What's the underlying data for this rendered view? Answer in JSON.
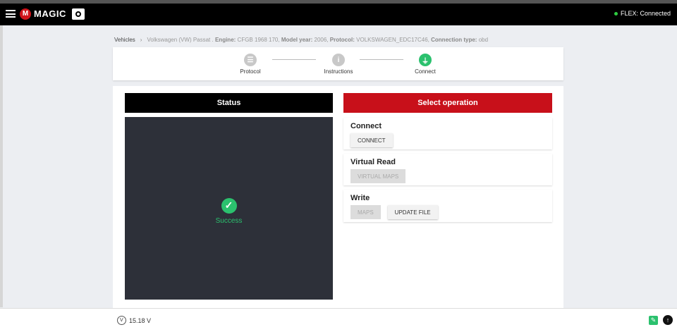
{
  "app": {
    "logo_letter": "M",
    "logo_text": "MAGIC",
    "connection_status": "FLEX: Connected"
  },
  "breadcrumb": {
    "root": "Vehicles",
    "vehicle": "Volkswagen (VW) Passat .",
    "engine_label": "Engine:",
    "engine_value": "CFGB 1968 170,",
    "year_label": "Model year:",
    "year_value": "2006,",
    "protocol_label": "Protocol:",
    "protocol_value": "VOLKSWAGEN_EDC17C46,",
    "conn_type_label": "Connection type:",
    "conn_type_value": "obd"
  },
  "stepper": {
    "steps": [
      {
        "label": "Protocol",
        "icon": "list-icon",
        "state": "inactive"
      },
      {
        "label": "Instructions",
        "icon": "info-icon",
        "state": "inactive"
      },
      {
        "label": "Connect",
        "icon": "plug-icon",
        "state": "done"
      }
    ]
  },
  "status": {
    "header": "Status",
    "result": "Success",
    "result_icon": "check-circle-icon"
  },
  "operations": {
    "header": "Select operation",
    "connect": {
      "title": "Connect",
      "button": "CONNECT"
    },
    "virtual_read": {
      "title": "Virtual Read",
      "button": "VIRTUAL MAPS"
    },
    "write": {
      "title": "Write",
      "maps_button": "MAPS",
      "update_button": "UPDATE FILE"
    }
  },
  "footer": {
    "voltage": "15.18 V",
    "voltage_icon_letter": "V"
  },
  "colors": {
    "topbar": "#000000",
    "brand_red": "#c8101a",
    "success_green": "#2bc16e",
    "status_box": "#2d3039"
  }
}
